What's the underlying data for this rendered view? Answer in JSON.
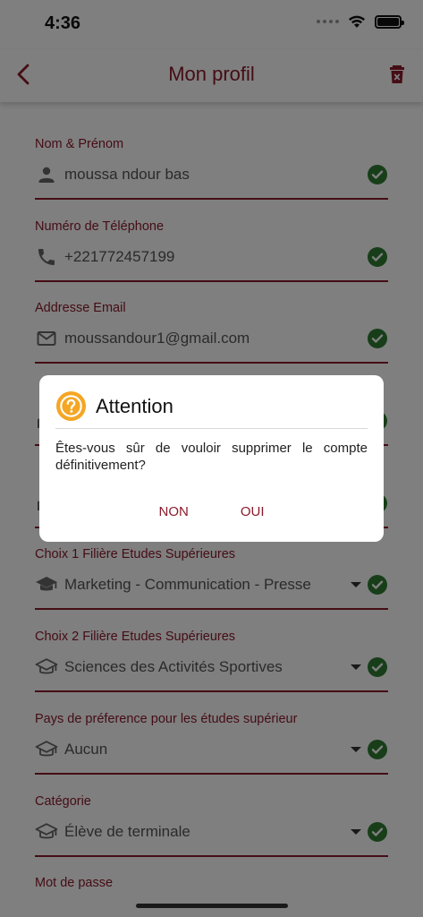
{
  "status_bar": {
    "time": "4:36"
  },
  "app_bar": {
    "title": "Mon profil"
  },
  "fields": [
    {
      "label": "Nom & Prénom",
      "value": "moussa ndour bas",
      "icon": "person-icon",
      "dropdown": false
    },
    {
      "label": "Numéro de Téléphone",
      "value": "+221772457199",
      "icon": "phone-icon",
      "dropdown": false
    },
    {
      "label": "Addresse Email",
      "value": "moussandour1@gmail.com",
      "icon": "mail-icon",
      "dropdown": false
    },
    {
      "label": "",
      "value": "",
      "icon": "school-icon",
      "dropdown": false
    },
    {
      "label": "",
      "value": "",
      "icon": "school-icon",
      "dropdown": true
    },
    {
      "label": "Choix 1 Filière Etudes Supérieures",
      "value": "Marketing - Communication - Presse",
      "icon": "graduation-cap-icon",
      "dropdown": true
    },
    {
      "label": "Choix 2 Filière Etudes Supérieures",
      "value": "Sciences des Activités Sportives",
      "icon": "graduation-cap-outline-icon",
      "dropdown": true
    },
    {
      "label": "Pays de préference pour les études supérieur",
      "value": "Aucun",
      "icon": "graduation-cap-outline-icon",
      "dropdown": true
    },
    {
      "label": "Catégorie",
      "value": "Élève de terminale",
      "icon": "graduation-cap-outline-icon",
      "dropdown": true
    },
    {
      "label": "Mot de passe",
      "value": "",
      "icon": "lock-icon",
      "dropdown": false
    }
  ],
  "dialog": {
    "title": "Attention",
    "message": "Êtes-vous sûr de vouloir supprimer le compte définitivement?",
    "cancel_label": "NON",
    "confirm_label": "OUI"
  },
  "colors": {
    "accent": "#8b1a2b",
    "check": "#2e7d32",
    "warning": "#f5a623"
  }
}
